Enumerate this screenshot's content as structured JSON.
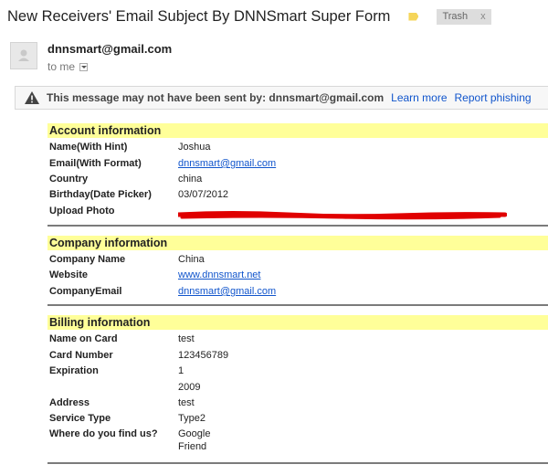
{
  "header": {
    "subject": "New Receivers' Email Subject By DNNSmart Super Form",
    "label_color": "#f5d55a",
    "trash_label": "Trash",
    "trash_close": "x"
  },
  "message": {
    "sender": "dnnsmart@gmail.com",
    "to": "to me"
  },
  "warning": {
    "text": "This message may not have been sent by: dnnsmart@gmail.com",
    "learn_more": "Learn more",
    "report": "Report phishing"
  },
  "account": {
    "title": "Account information",
    "rows": [
      {
        "label": "Name(With Hint)",
        "value": "Joshua"
      },
      {
        "label": "Email(With Format)",
        "value": "dnnsmart@gmail.com"
      },
      {
        "label": "Country",
        "value": "china"
      },
      {
        "label": "Birthday(Date Picker)",
        "value": "03/07/2012"
      },
      {
        "label": "Upload Photo",
        "value": ""
      }
    ]
  },
  "company": {
    "title": "Company information",
    "rows": [
      {
        "label": "Company Name",
        "value": "China"
      },
      {
        "label": "Website",
        "value": "www.dnnsmart.net"
      },
      {
        "label": "CompanyEmail",
        "value": "dnnsmart@gmail.com"
      }
    ]
  },
  "billing": {
    "title": "Billing information",
    "rows": [
      {
        "label": "Name on Card",
        "value": "test"
      },
      {
        "label": "Card Number",
        "value": "123456789"
      },
      {
        "label": "Expiration",
        "value": "1"
      },
      {
        "label": "",
        "value": "2009"
      },
      {
        "label": "Address",
        "value": "test"
      },
      {
        "label": "Service Type",
        "value": "Type2"
      },
      {
        "label": "Where do you find us?",
        "value": "Google"
      },
      {
        "label": "",
        "value": "Friend"
      }
    ]
  },
  "colors": {
    "section_bg": "#ffff99",
    "link": "#1155cc",
    "redaction": "#e00000"
  }
}
